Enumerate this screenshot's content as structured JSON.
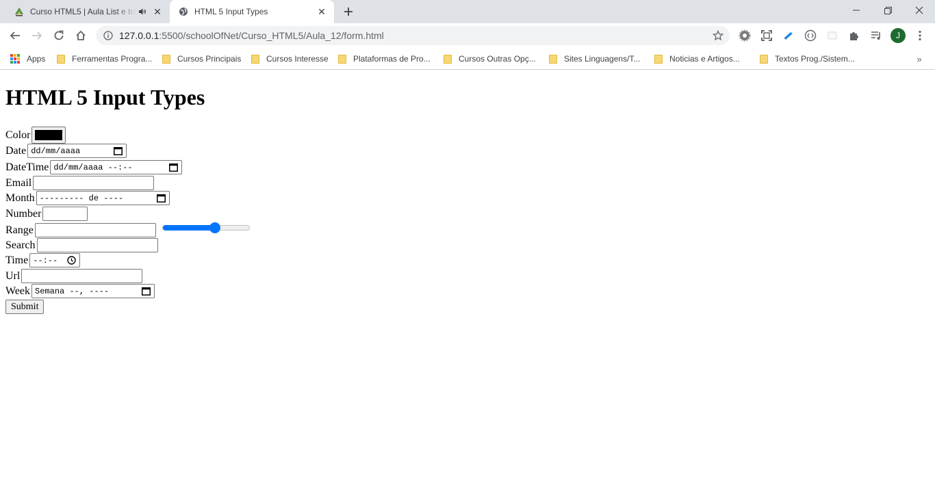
{
  "browser": {
    "tabs": [
      {
        "title": "Curso HTML5 | Aula List e tra",
        "active": false,
        "audio": true
      },
      {
        "title": "HTML 5 Input Types",
        "active": true,
        "audio": false
      }
    ],
    "url_host": "127.0.0.1",
    "url_rest": ":5500/schoolOfNet/Curso_HTML5/Aula_12/form.html",
    "avatar_initial": "J",
    "bookmarks": [
      "Apps",
      "Ferramentas Progra...",
      "Cursos Principais",
      "Cursos Interesse",
      "Plataformas de Pro...",
      "Cursos Outras Opç...",
      "Sites Linguagens/T...",
      "Noticias e Artigos...",
      "Textos Prog./Sistem..."
    ],
    "bookmarks_more": "»"
  },
  "page": {
    "heading": "HTML 5 Input Types",
    "form": {
      "color": {
        "label": "Color",
        "value": "#000000"
      },
      "date": {
        "label": "Date",
        "placeholder": "dd/mm/aaaa"
      },
      "datetime": {
        "label": "DateTime",
        "placeholder": "dd/mm/aaaa --:--"
      },
      "email": {
        "label": "Email",
        "value": ""
      },
      "month": {
        "label": "Month",
        "placeholder": "--------- de ----"
      },
      "number": {
        "label": "Number",
        "value": ""
      },
      "range": {
        "label": "Range",
        "text_value": "",
        "slider_fraction": 0.6
      },
      "search": {
        "label": "Search",
        "value": ""
      },
      "time": {
        "label": "Time",
        "placeholder": "--:--"
      },
      "url": {
        "label": "Url",
        "value": ""
      },
      "week": {
        "label": "Week",
        "placeholder": "Semana --, ----"
      },
      "submit_label": "Submit"
    }
  },
  "colors": {
    "tabstrip_bg": "#dee1e6",
    "accent": "#0075ff",
    "avatar_bg": "#1e6b2f"
  }
}
